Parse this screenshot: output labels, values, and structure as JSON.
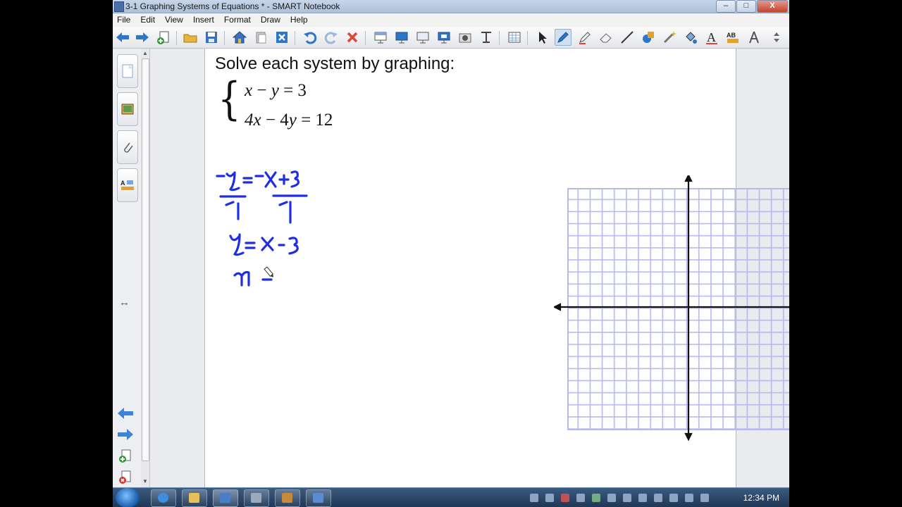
{
  "window": {
    "title": "3-1 Graphing Systems of Equations * - SMART Notebook",
    "buttons": {
      "minimize": "–",
      "maximize": "□",
      "close": "X"
    }
  },
  "menubar": {
    "items": [
      "File",
      "Edit",
      "View",
      "Insert",
      "Format",
      "Draw",
      "Help"
    ]
  },
  "toolbar": {
    "icons": [
      "back-arrow-icon",
      "forward-arrow-icon",
      "add-page-icon",
      "open-folder-icon",
      "save-icon",
      "home-icon",
      "paste-icon",
      "delete-page-icon",
      "undo-icon",
      "redo-icon",
      "delete-icon",
      "screen-shade-icon",
      "full-screen-icon",
      "dual-screen-icon",
      "capture-icon",
      "camera-icon",
      "table-icon",
      "select-arrow-icon",
      "pen-icon",
      "creative-pen-icon",
      "eraser-icon",
      "line-icon",
      "shape-icon",
      "magic-pen-icon",
      "fill-icon",
      "text-icon",
      "properties-icon",
      "compass-icon",
      "toolbar-arrows-icon"
    ],
    "active": "pen-icon"
  },
  "sidebar": {
    "tabs": [
      "page-sorter",
      "gallery",
      "attachments",
      "properties"
    ],
    "collapse_glyph": "↔"
  },
  "page": {
    "heading": "Solve each system by graphing:",
    "equation1": {
      "a": "x",
      "op": " − ",
      "b": "y",
      "rhs": " = 3"
    },
    "equation2": {
      "a": "4x",
      "op": " − 4",
      "b": "y",
      "rhs": " = 12"
    },
    "handwriting_color": "#1e2ee6",
    "grid": {
      "color": "#b8b9f0",
      "cells": 20
    }
  },
  "taskbar": {
    "clock": "12:34 PM"
  }
}
